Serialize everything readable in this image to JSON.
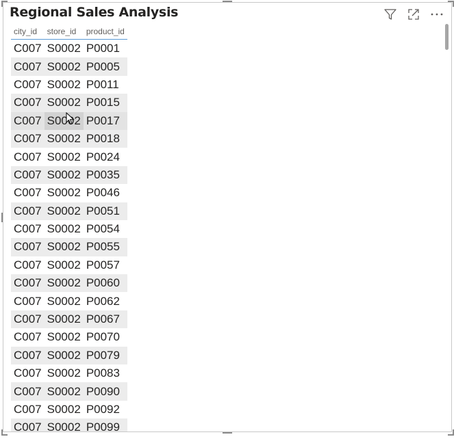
{
  "visual": {
    "title": "Regional Sales Analysis",
    "header_icons": [
      "filter-icon",
      "focus-mode-icon",
      "more-options-icon"
    ]
  },
  "table": {
    "columns": [
      "city_id",
      "store_id",
      "product_id"
    ],
    "rows": [
      [
        "C007",
        "S0002",
        "P0001"
      ],
      [
        "C007",
        "S0002",
        "P0005"
      ],
      [
        "C007",
        "S0002",
        "P0011"
      ],
      [
        "C007",
        "S0002",
        "P0015"
      ],
      [
        "C007",
        "S0002",
        "P0017"
      ],
      [
        "C007",
        "S0002",
        "P0018"
      ],
      [
        "C007",
        "S0002",
        "P0024"
      ],
      [
        "C007",
        "S0002",
        "P0035"
      ],
      [
        "C007",
        "S0002",
        "P0046"
      ],
      [
        "C007",
        "S0002",
        "P0051"
      ],
      [
        "C007",
        "S0002",
        "P0054"
      ],
      [
        "C007",
        "S0002",
        "P0055"
      ],
      [
        "C007",
        "S0002",
        "P0057"
      ],
      [
        "C007",
        "S0002",
        "P0060"
      ],
      [
        "C007",
        "S0002",
        "P0062"
      ],
      [
        "C007",
        "S0002",
        "P0067"
      ],
      [
        "C007",
        "S0002",
        "P0070"
      ],
      [
        "C007",
        "S0002",
        "P0079"
      ],
      [
        "C007",
        "S0002",
        "P0083"
      ],
      [
        "C007",
        "S0002",
        "P0090"
      ],
      [
        "C007",
        "S0002",
        "P0092"
      ],
      [
        "C007",
        "S0002",
        "P0099"
      ]
    ]
  },
  "colors": {
    "header_underline": "#5b9bd5",
    "band_row": "#ececec",
    "hover_cell": "#d2d2d2",
    "text": "#252423"
  }
}
